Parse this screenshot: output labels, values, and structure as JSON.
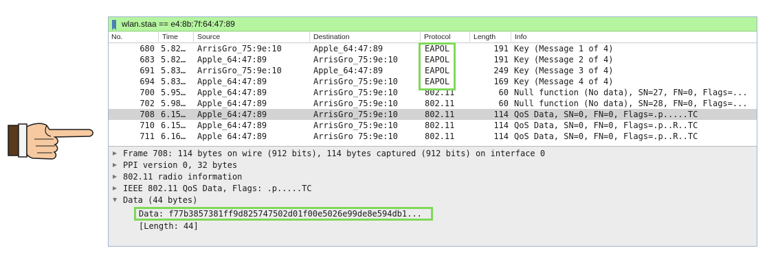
{
  "filter": {
    "text": "wlan.staa == e4:8b:7f:64:47:89"
  },
  "columns": {
    "no": "No.",
    "time": "Time",
    "source": "Source",
    "destination": "Destination",
    "protocol": "Protocol",
    "length": "Length",
    "info": "Info"
  },
  "packets": [
    {
      "no": "680",
      "time": "5.82…",
      "source": "ArrisGro_75:9e:10",
      "destination": "Apple_64:47:89",
      "protocol": "EAPOL",
      "length": "191",
      "info": "Key (Message 1 of 4)"
    },
    {
      "no": "683",
      "time": "5.82…",
      "source": "Apple_64:47:89",
      "destination": "ArrisGro_75:9e:10",
      "protocol": "EAPOL",
      "length": "191",
      "info": "Key (Message 2 of 4)"
    },
    {
      "no": "691",
      "time": "5.83…",
      "source": "ArrisGro_75:9e:10",
      "destination": "Apple_64:47:89",
      "protocol": "EAPOL",
      "length": "249",
      "info": "Key (Message 3 of 4)"
    },
    {
      "no": "694",
      "time": "5.83…",
      "source": "Apple_64:47:89",
      "destination": "ArrisGro_75:9e:10",
      "protocol": "EAPOL",
      "length": "169",
      "info": "Key (Message 4 of 4)"
    },
    {
      "no": "700",
      "time": "5.95…",
      "source": "Apple_64:47:89",
      "destination": "ArrisGro_75:9e:10",
      "protocol": "802.11",
      "length": "60",
      "info": "Null function (No data), SN=27, FN=0, Flags=..."
    },
    {
      "no": "702",
      "time": "5.98…",
      "source": "Apple_64:47:89",
      "destination": "ArrisGro_75:9e:10",
      "protocol": "802.11",
      "length": "60",
      "info": "Null function (No data), SN=28, FN=0, Flags=..."
    },
    {
      "no": "708",
      "time": "6.15…",
      "source": "Apple_64:47:89",
      "destination": "ArrisGro_75:9e:10",
      "protocol": "802.11",
      "length": "114",
      "info": "QoS Data, SN=0, FN=0, Flags=.p.....TC"
    },
    {
      "no": "710",
      "time": "6.15…",
      "source": "Apple_64:47:89",
      "destination": "ArrisGro_75:9e:10",
      "protocol": "802.11",
      "length": "114",
      "info": "QoS Data, SN=0, FN=0, Flags=.p..R..TC"
    },
    {
      "no": "711",
      "time": "6.16…",
      "source": "Apple 64:47:89",
      "destination": "ArrisGro 75:9e:10",
      "protocol": "802.11",
      "length": "114",
      "info": "QoS Data, SN=0, FN=0, Flags=.p..R..TC"
    }
  ],
  "selected_packet": "708",
  "details": [
    {
      "text": "Frame 708: 114 bytes on wire (912 bits), 114 bytes captured (912 bits) on interface 0",
      "arrow": "▶"
    },
    {
      "text": "PPI version 0, 32 bytes",
      "arrow": "▶"
    },
    {
      "text": "802.11 radio information",
      "arrow": "▶"
    },
    {
      "text": "IEEE 802.11 QoS Data, Flags: .p.....TC",
      "arrow": "▶"
    },
    {
      "text": "Data (44 bytes)",
      "arrow": "▼"
    },
    {
      "text": "Data: f77b3857381ff9d825747502d01f00e5026e99de8e594db1...",
      "arrow": ""
    },
    {
      "text": "[Length: 44]",
      "arrow": ""
    }
  ],
  "colors": {
    "filter_bg": "#b6f5a0",
    "highlight_box": "#7ed957",
    "selected_row": "#d3d3d3",
    "details_bg": "#ececec"
  },
  "icons": {
    "filter": "bookmark-icon",
    "pointer": "pointing-hand-icon"
  }
}
